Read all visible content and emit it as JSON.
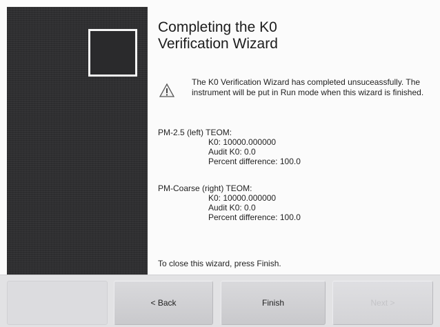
{
  "wizard": {
    "title_line1": "Completing the K0",
    "title_line2": "Verification Wizard",
    "warning": {
      "icon": "warning-triangle-icon",
      "text": "The K0 Verification Wizard has completed unsuceassfully. The instrument will be put in Run mode when this wizard is finished."
    },
    "left_teom": {
      "heading": "PM-2.5 (left) TEOM:",
      "k0": "K0: 10000.000000",
      "audit_k0": "Audit K0: 0.0",
      "percent_difference": "Percent difference: 100.0"
    },
    "right_teom": {
      "heading": "PM-Coarse (right) TEOM:",
      "k0": "K0: 10000.000000",
      "audit_k0": "Audit K0: 0.0",
      "percent_difference": "Percent difference: 100.0"
    },
    "close_hint": "To close this wizard, press Finish."
  },
  "buttons": {
    "back_label": "< Back",
    "finish_label": "Finish",
    "next_label": "Next >"
  },
  "colors": {
    "left_panel": "#2f2f31",
    "button_bar": "#e2e2e4",
    "disabled_text": "#c4c4c7"
  }
}
